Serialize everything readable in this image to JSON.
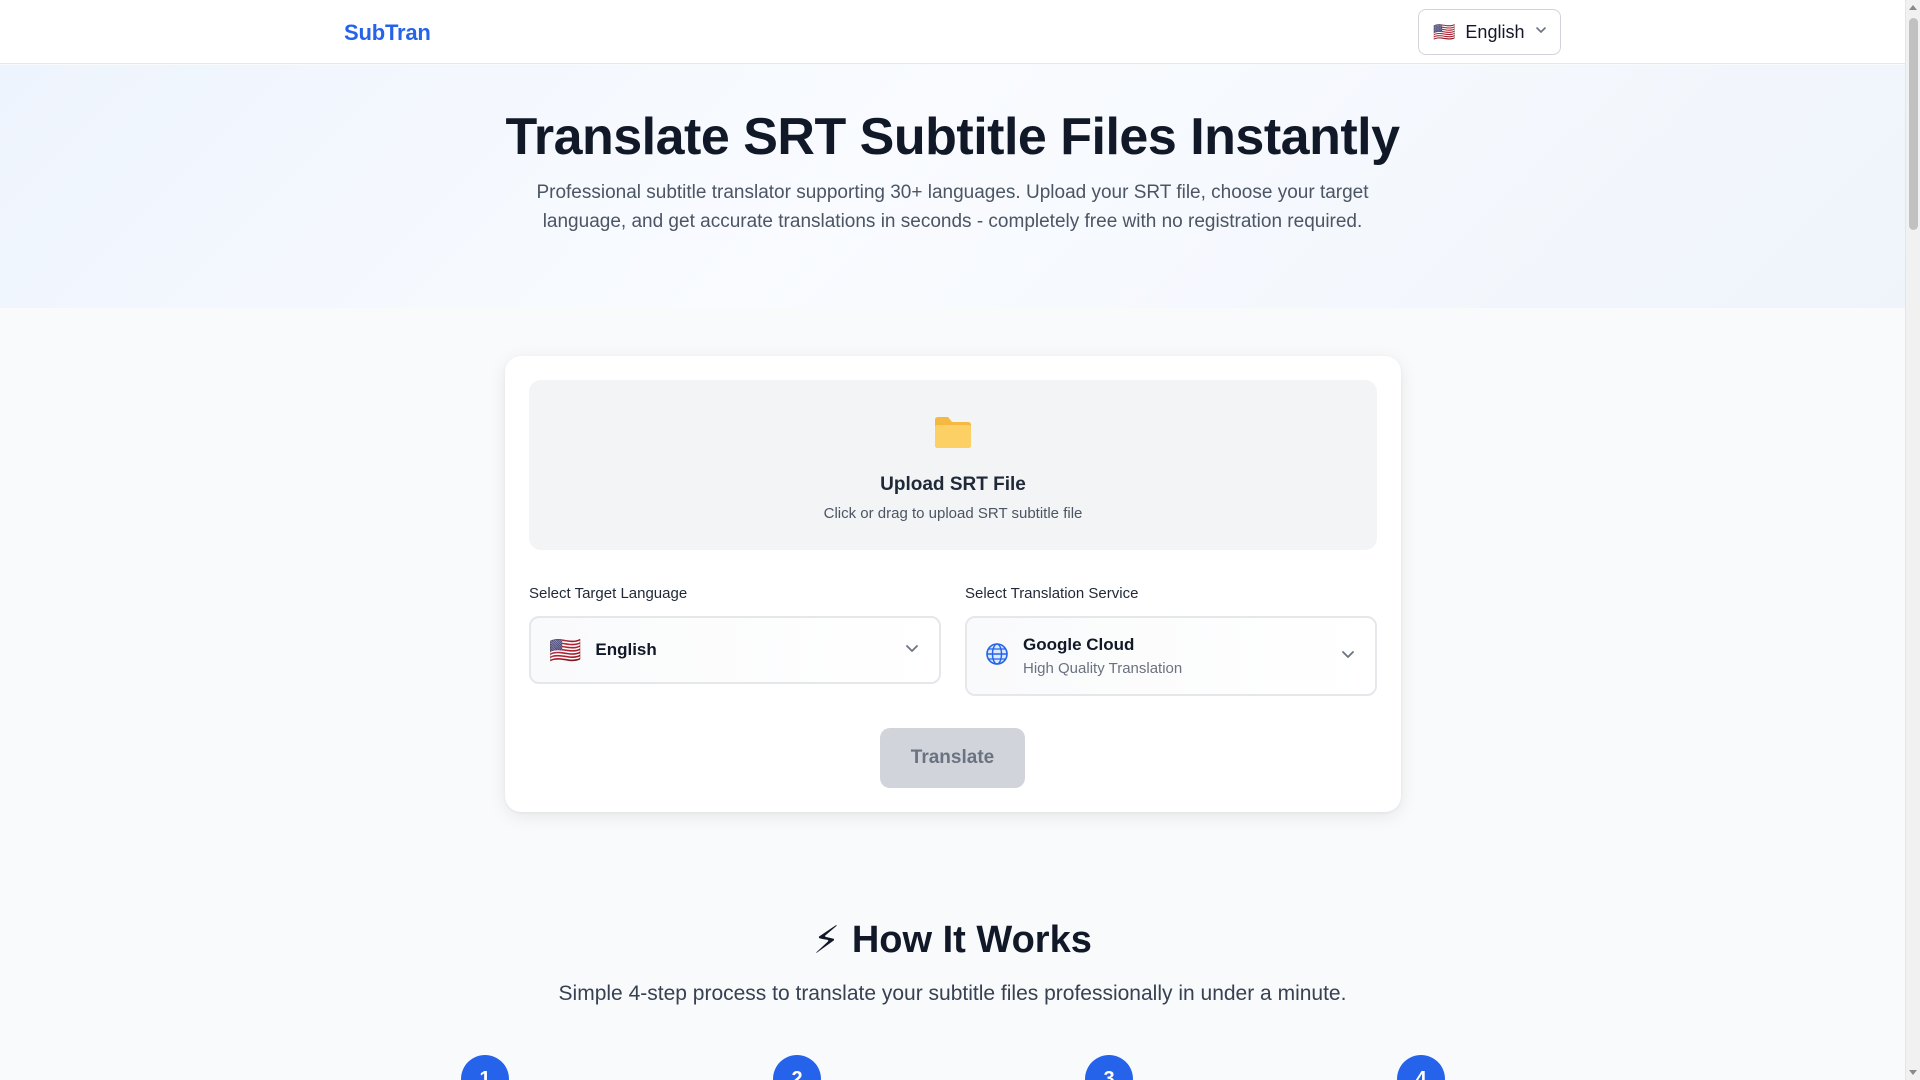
{
  "header": {
    "logo": "SubTran",
    "language_switch": {
      "flag": "🇺🇸",
      "label": "English"
    }
  },
  "hero": {
    "title": "Translate SRT Subtitle Files Instantly",
    "description": "Professional subtitle translator supporting 30+ languages. Upload your SRT file, choose your target language, and get accurate translations in seconds - completely free with no registration required."
  },
  "upload": {
    "icon": "📁",
    "title": "Upload SRT File",
    "hint": "Click or drag to upload SRT subtitle file"
  },
  "target_language": {
    "label": "Select Target Language",
    "flag": "🇺🇸",
    "value": "English"
  },
  "translation_service": {
    "label": "Select Translation Service",
    "icon": "globe-icon",
    "name": "Google Cloud",
    "description": "High Quality Translation"
  },
  "translate_button": {
    "label": "Translate",
    "enabled": false
  },
  "how_it_works": {
    "icon": "⚡",
    "title": "How It Works",
    "subtitle": "Simple 4-step process to translate your subtitle files professionally in under a minute.",
    "steps": [
      "1",
      "2",
      "3",
      "4"
    ]
  },
  "colors": {
    "brand": "#2563eb",
    "disabled_button": "#d1d5db",
    "text": "#111827"
  }
}
